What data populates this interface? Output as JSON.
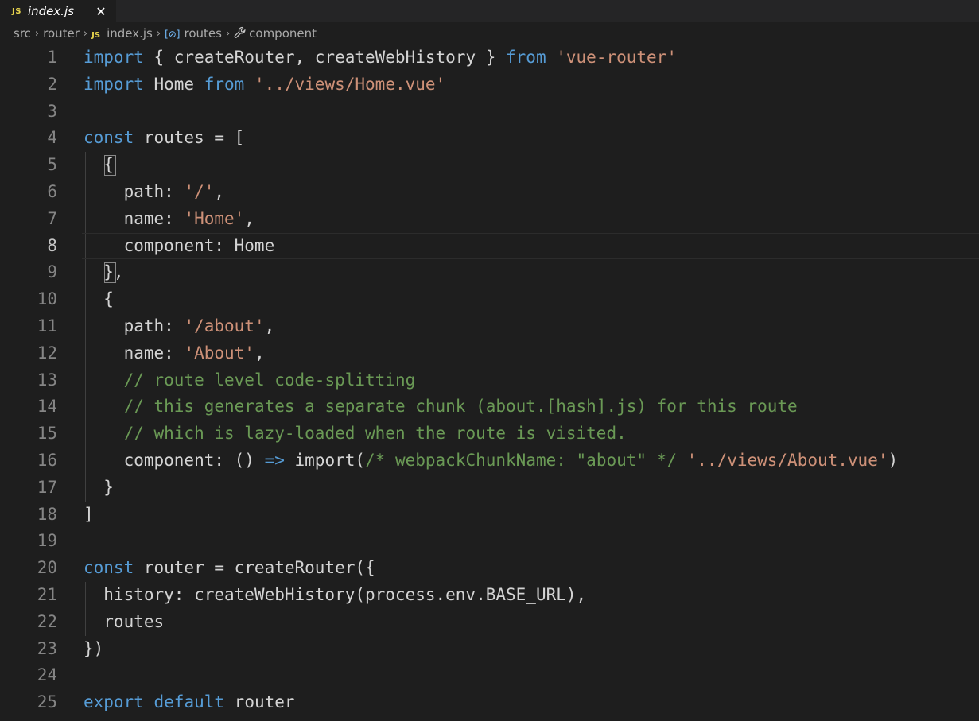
{
  "tab": {
    "icon": "JS",
    "label": "index.js",
    "close": "✕"
  },
  "breadcrumb": {
    "items": [
      "src",
      "router",
      "index.js",
      "routes",
      "component"
    ],
    "separator": "›",
    "js_icon": "JS",
    "icons": [
      "javascript-file-icon",
      "variable-icon",
      "wrench-icon"
    ]
  },
  "editor": {
    "active_line": 8,
    "line_numbers": [
      "1",
      "2",
      "3",
      "4",
      "5",
      "6",
      "7",
      "8",
      "9",
      "10",
      "11",
      "12",
      "13",
      "14",
      "15",
      "16",
      "17",
      "18",
      "19",
      "20",
      "21",
      "22",
      "23",
      "24",
      "25"
    ],
    "lines": [
      [
        {
          "t": "import",
          "c": "kw"
        },
        {
          "t": " { createRouter, createWebHistory } ",
          "c": ""
        },
        {
          "t": "from",
          "c": "kw"
        },
        {
          "t": " ",
          "c": ""
        },
        {
          "t": "'vue-router'",
          "c": "str"
        }
      ],
      [
        {
          "t": "import",
          "c": "kw"
        },
        {
          "t": " Home ",
          "c": ""
        },
        {
          "t": "from",
          "c": "kw"
        },
        {
          "t": " ",
          "c": ""
        },
        {
          "t": "'../views/Home.vue'",
          "c": "str"
        }
      ],
      [],
      [
        {
          "t": "const",
          "c": "kw"
        },
        {
          "t": " routes = [",
          "c": ""
        }
      ],
      [
        {
          "t": "  {",
          "c": ""
        }
      ],
      [
        {
          "t": "    path: ",
          "c": ""
        },
        {
          "t": "'/'",
          "c": "str"
        },
        {
          "t": ",",
          "c": ""
        }
      ],
      [
        {
          "t": "    name: ",
          "c": ""
        },
        {
          "t": "'Home'",
          "c": "str"
        },
        {
          "t": ",",
          "c": ""
        }
      ],
      [
        {
          "t": "    component: Home",
          "c": ""
        }
      ],
      [
        {
          "t": "  },",
          "c": ""
        }
      ],
      [
        {
          "t": "  {",
          "c": ""
        }
      ],
      [
        {
          "t": "    path: ",
          "c": ""
        },
        {
          "t": "'/about'",
          "c": "str"
        },
        {
          "t": ",",
          "c": ""
        }
      ],
      [
        {
          "t": "    name: ",
          "c": ""
        },
        {
          "t": "'About'",
          "c": "str"
        },
        {
          "t": ",",
          "c": ""
        }
      ],
      [
        {
          "t": "    ",
          "c": ""
        },
        {
          "t": "// route level code-splitting",
          "c": "cm"
        }
      ],
      [
        {
          "t": "    ",
          "c": ""
        },
        {
          "t": "// this generates a separate chunk (about.[hash].js) for this route",
          "c": "cm"
        }
      ],
      [
        {
          "t": "    ",
          "c": ""
        },
        {
          "t": "// which is lazy-loaded when the route is visited.",
          "c": "cm"
        }
      ],
      [
        {
          "t": "    component: () ",
          "c": ""
        },
        {
          "t": "=>",
          "c": "kw"
        },
        {
          "t": " import(",
          "c": ""
        },
        {
          "t": "/* webpackChunkName: \"about\" */",
          "c": "cm"
        },
        {
          "t": " ",
          "c": ""
        },
        {
          "t": "'../views/About.vue'",
          "c": "str"
        },
        {
          "t": ")",
          "c": ""
        }
      ],
      [
        {
          "t": "  }",
          "c": ""
        }
      ],
      [
        {
          "t": "]",
          "c": ""
        }
      ],
      [],
      [
        {
          "t": "const",
          "c": "kw"
        },
        {
          "t": " router = createRouter({",
          "c": ""
        }
      ],
      [
        {
          "t": "  history: createWebHistory(process.env.BASE_URL),",
          "c": ""
        }
      ],
      [
        {
          "t": "  routes",
          "c": ""
        }
      ],
      [
        {
          "t": "})",
          "c": ""
        }
      ],
      [],
      [
        {
          "t": "export",
          "c": "kw"
        },
        {
          "t": " ",
          "c": ""
        },
        {
          "t": "default",
          "c": "kw"
        },
        {
          "t": " router",
          "c": ""
        }
      ]
    ]
  }
}
